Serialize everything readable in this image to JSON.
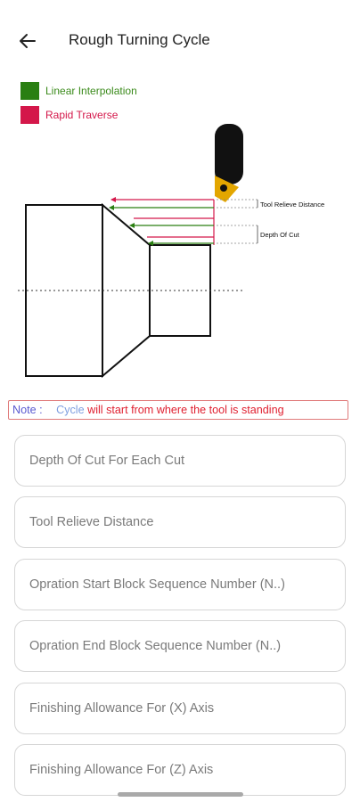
{
  "header": {
    "title": "Rough Turning Cycle",
    "back_icon": "arrow-left-icon"
  },
  "legend": [
    {
      "label": "Linear Interpolation",
      "color": "#2a7f12",
      "text_color": "#3a8a1a"
    },
    {
      "label": "Rapid Traverse",
      "color": "#d4174a",
      "text_color": "#d4174a"
    }
  ],
  "diagram": {
    "labels": {
      "tool_relieve": "Tool Relieve Distance",
      "depth_of_cut": "Depth Of Cut"
    }
  },
  "note": {
    "prefix": "Note :",
    "word": "Cycle",
    "rest": "will start from where the tool is standing"
  },
  "form": {
    "fields": [
      {
        "placeholder": "Depth Of Cut For Each Cut",
        "value": ""
      },
      {
        "placeholder": "Tool Relieve Distance",
        "value": ""
      },
      {
        "placeholder": "Opration Start Block Sequence Number (N..)",
        "value": ""
      },
      {
        "placeholder": "Opration End Block Sequence Number (N..)",
        "value": ""
      },
      {
        "placeholder": "Finishing Allowance For (X) Axis",
        "value": ""
      },
      {
        "placeholder": "Finishing Allowance For (Z) Axis",
        "value": ""
      }
    ]
  }
}
